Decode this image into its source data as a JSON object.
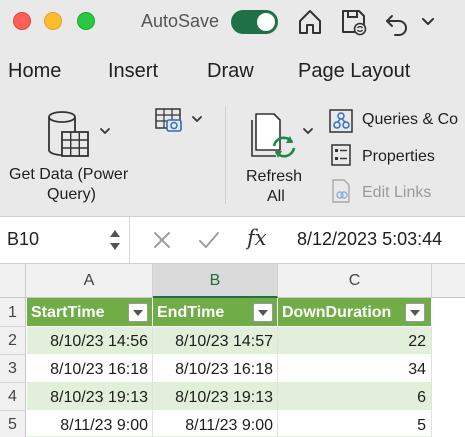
{
  "titlebar": {
    "autosave_label": "AutoSave",
    "autosave_on": true,
    "icons": [
      "home-icon",
      "save-icon",
      "undo-icon",
      "chevron-down-icon"
    ]
  },
  "tabs": [
    "Home",
    "Insert",
    "Draw",
    "Page Layout"
  ],
  "ribbon": {
    "get_data_label_line1": "Get Data (Power",
    "get_data_label_line2": "Query)",
    "refresh_label_line1": "Refresh",
    "refresh_label_line2": "All",
    "queries_label": "Queries & Co",
    "properties_label": "Properties",
    "edit_links_label": "Edit Links"
  },
  "formula_bar": {
    "name_box": "B10",
    "fx": "fx",
    "value": "8/12/2023  5:03:44"
  },
  "grid": {
    "column_headers": [
      "A",
      "B",
      "C"
    ],
    "selected_column": "B",
    "row_numbers": [
      "1",
      "2",
      "3",
      "4",
      "5"
    ],
    "table_headers": [
      "StartTime",
      "EndTime",
      "DownDuration"
    ],
    "rows": [
      [
        "8/10/23 14:56",
        "8/10/23 14:57",
        "22"
      ],
      [
        "8/10/23 16:18",
        "8/10/23 16:18",
        "34"
      ],
      [
        "8/10/23 19:13",
        "8/10/23 19:13",
        "6"
      ],
      [
        "8/11/23 9:00",
        "8/11/23 9:00",
        "5"
      ]
    ]
  },
  "colors": {
    "accent": "#1e7145",
    "table_header": "#70ad47",
    "table_band": "#e2efda"
  }
}
